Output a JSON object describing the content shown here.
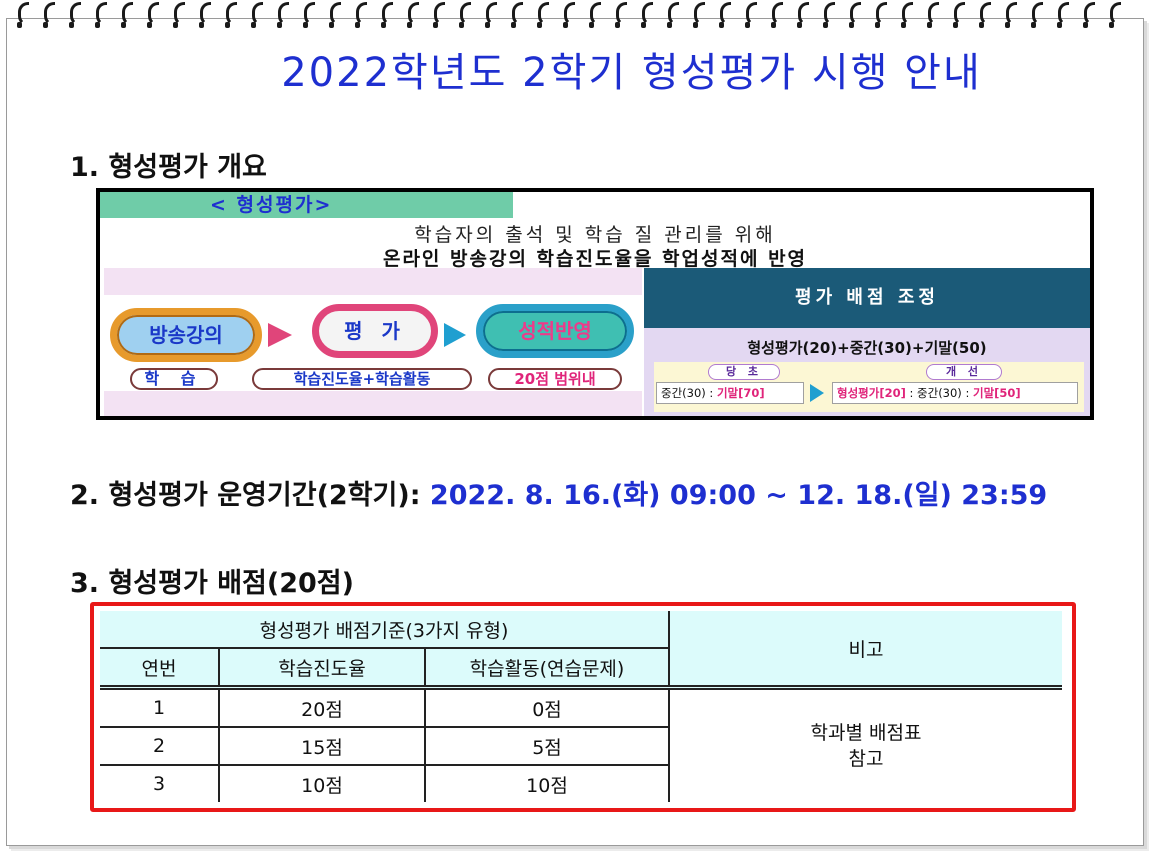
{
  "title": "2022학년도 2학기 형성평가 시행 안내",
  "section1": {
    "heading": "1. 형성평가 개요",
    "tab_label": "< 형성평가>",
    "line1": "학습자의 출석 및 학습 질 관리를 위해",
    "line2": "온라인 방송강의 학습진도율을 학업성적에 반영",
    "flow": {
      "step1": "방송강의",
      "step2": "평 가",
      "step3": "성적반영",
      "sub1": "학 습",
      "sub2": "학습진도율+학습활동",
      "sub3": "20점 범위내"
    },
    "adjustment": {
      "heading": "평가 배점 조정",
      "formula": "형성평가(20)+중간(30)+기말(50)",
      "before_label": "당 초",
      "after_label": "개 선",
      "before_mid": "중간(30) : ",
      "before_final": "기말[70]",
      "after_formative": "형성평가[20]",
      "after_mid": " : 중간(30) : ",
      "after_final": "기말[50]"
    }
  },
  "section2": {
    "heading": "2. 형성평가 운영기간(2학기): ",
    "period": "2022. 8. 16.(화) 09:00 ~ 12. 18.(일) 23:59"
  },
  "section3": {
    "heading": "3. 형성평가 배점(20점)",
    "table": {
      "group_header": "형성평가 배점기준(3가지 유형)",
      "remark_header": "비고",
      "columns": [
        "연번",
        "학습진도율",
        "학습활동(연습문제)"
      ],
      "rows": [
        [
          "1",
          "20점",
          "0점"
        ],
        [
          "2",
          "15점",
          "5점"
        ],
        [
          "3",
          "10점",
          "10점"
        ]
      ],
      "remark_line1": "학과별 배점표",
      "remark_line2": "참고"
    }
  },
  "colors": {
    "title_blue": "#1e2fd0",
    "table_border_red": "#e81818",
    "table_header_bg": "#dcfbfb",
    "tab_green": "#6fcca8",
    "adjust_header_bg": "#1b5a78"
  }
}
